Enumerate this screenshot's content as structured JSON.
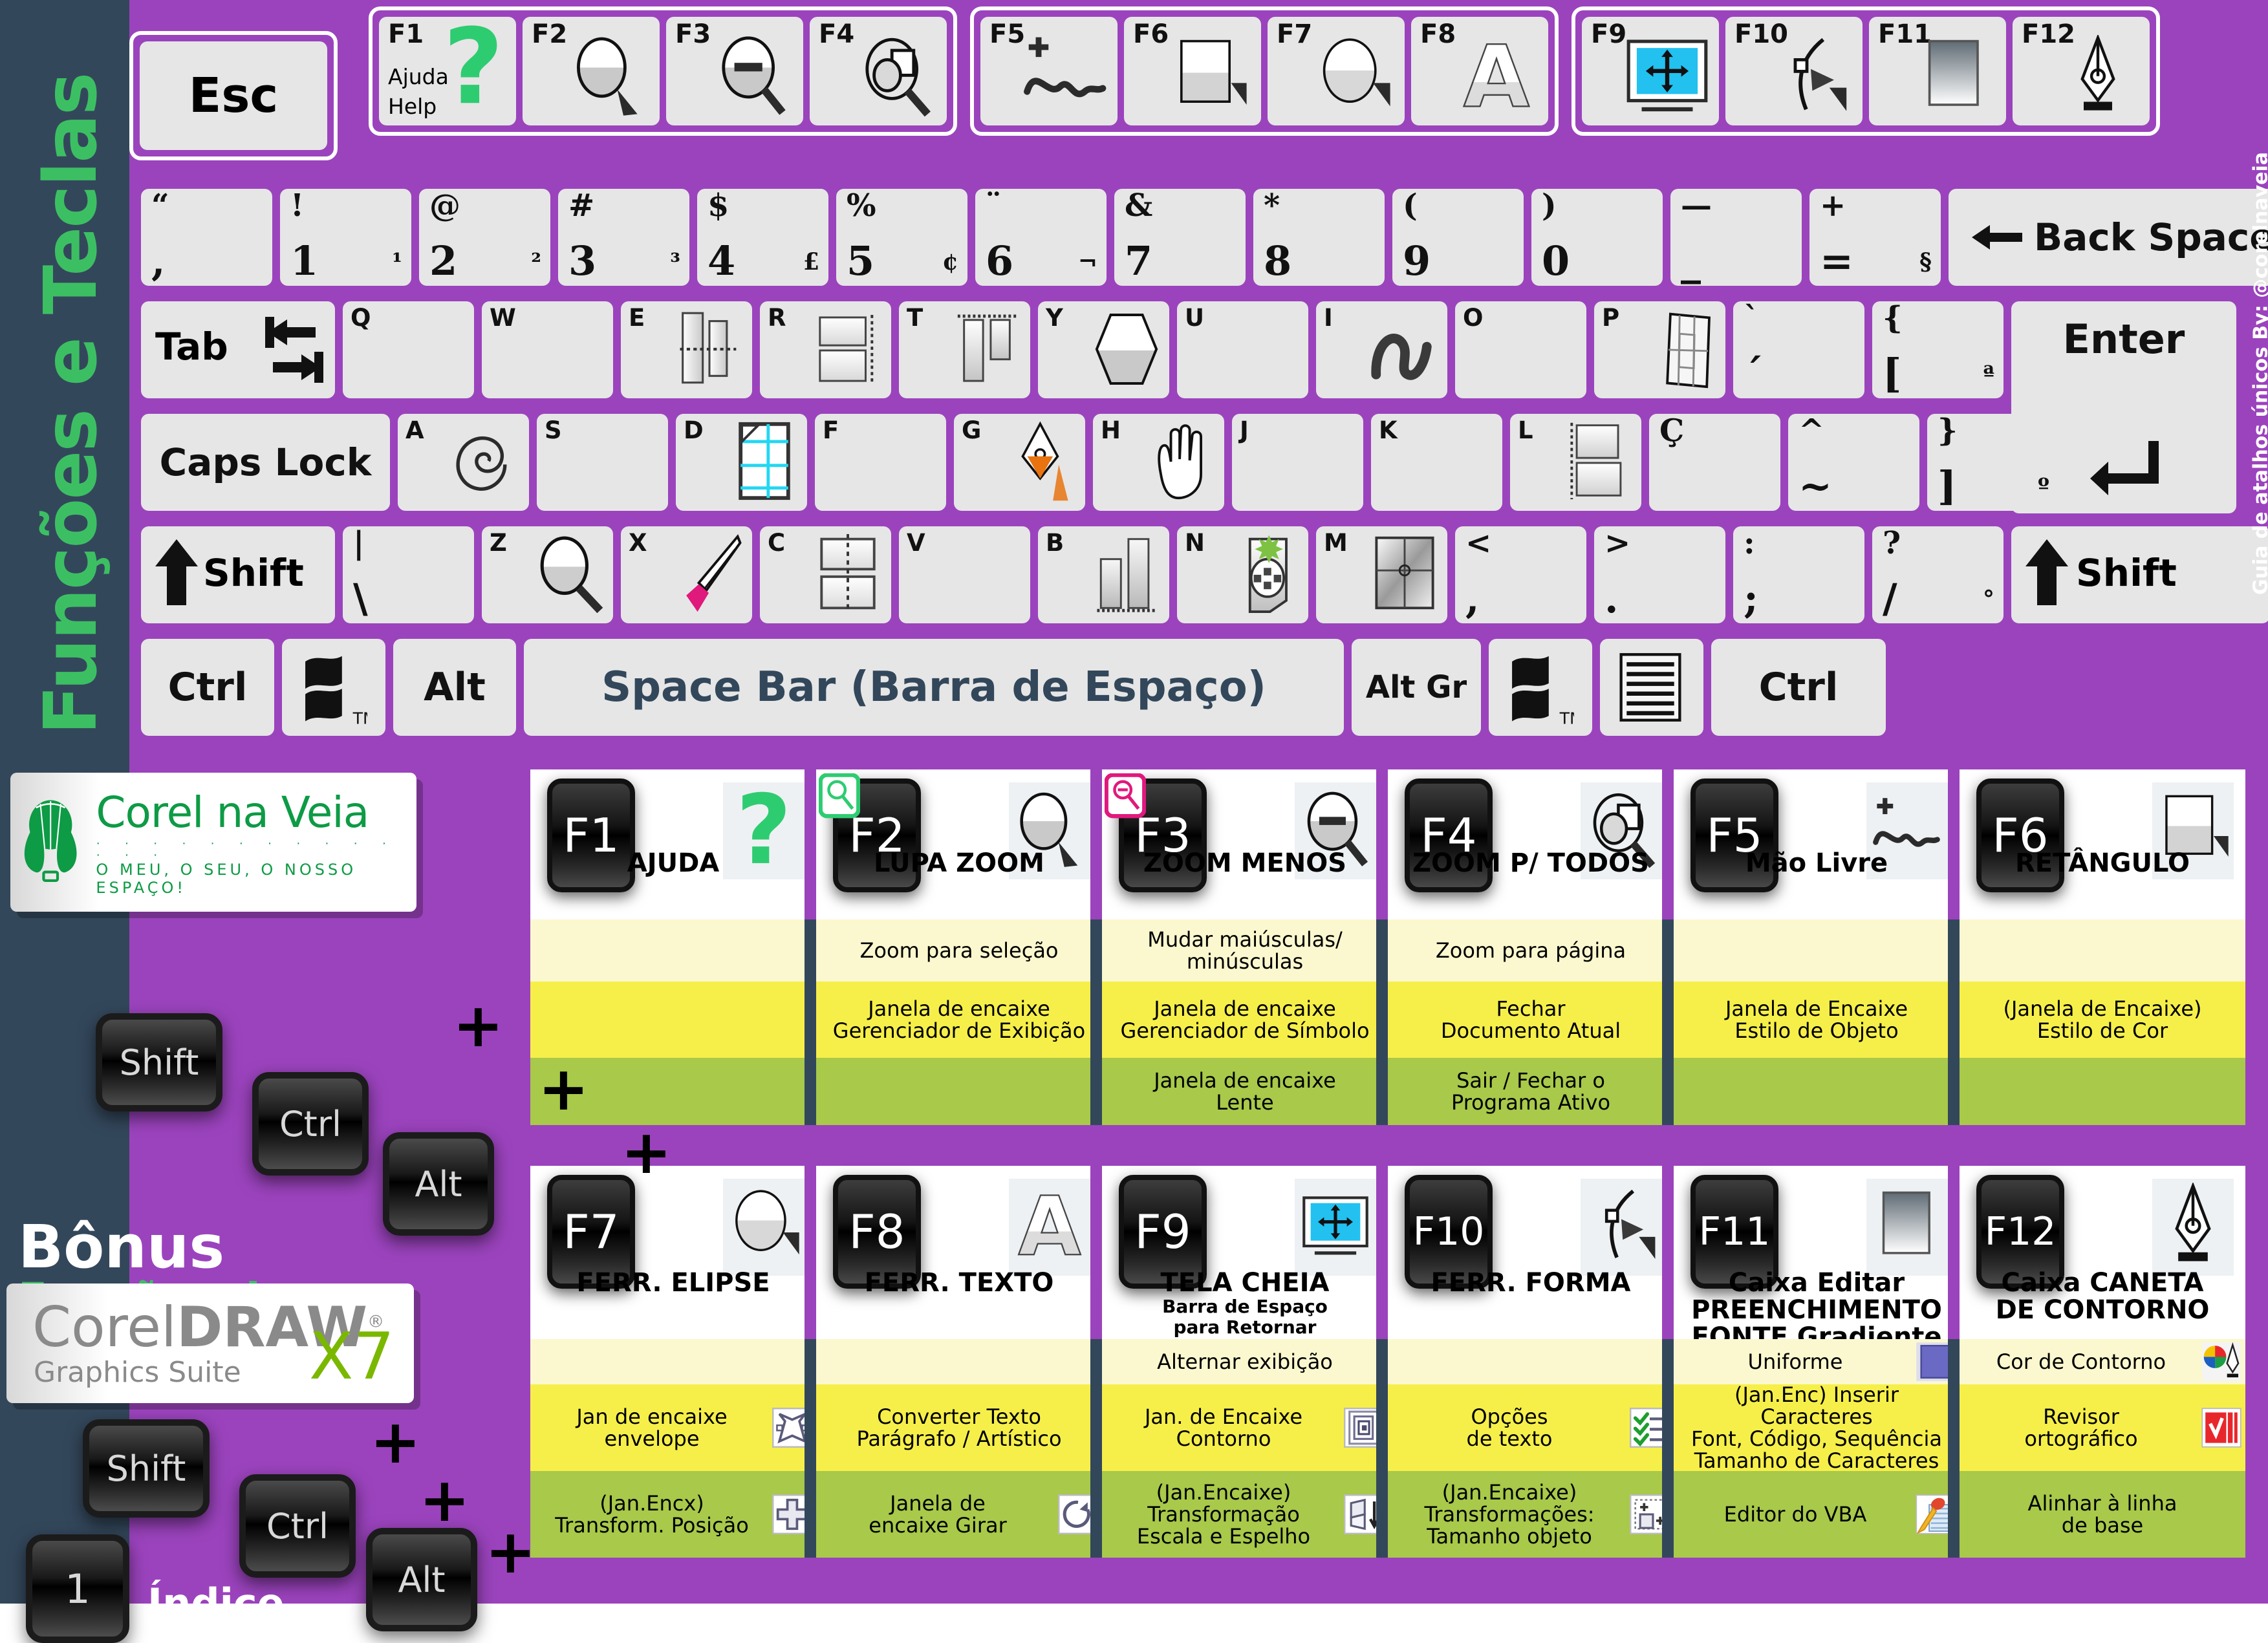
{
  "sidebar": {
    "title": "Funções e Teclas"
  },
  "right_credit": {
    "text": "Guia de atalhos únicos By: @corelnaveia"
  },
  "keyboard": {
    "esc": "Esc",
    "fn_top": [
      {
        "key": "F1",
        "icon": "help-question-icon",
        "label_top": "Ajuda",
        "label_bottom": "Help"
      },
      {
        "key": "F2",
        "icon": "zoom-in-magnifier-icon"
      },
      {
        "key": "F3",
        "icon": "zoom-out-magnifier-icon"
      },
      {
        "key": "F4",
        "icon": "zoom-all-objects-icon"
      },
      {
        "key": "F5",
        "icon": "freehand-curve-icon"
      },
      {
        "key": "F6",
        "icon": "rectangle-tool-icon"
      },
      {
        "key": "F7",
        "icon": "ellipse-tool-icon"
      },
      {
        "key": "F8",
        "icon": "text-tool-icon"
      },
      {
        "key": "F9",
        "icon": "fullscreen-preview-icon"
      },
      {
        "key": "F10",
        "icon": "shape-tool-icon"
      },
      {
        "key": "F11",
        "icon": "fountain-fill-icon"
      },
      {
        "key": "F12",
        "icon": "outline-pen-icon"
      }
    ],
    "number_row": [
      {
        "top": "“",
        "bottom": ","
      },
      {
        "top": "!",
        "bottom": "1",
        "alt": "¹"
      },
      {
        "top": "@",
        "bottom": "2",
        "alt": "²"
      },
      {
        "top": "#",
        "bottom": "3",
        "alt": "³"
      },
      {
        "top": "$",
        "bottom": "4",
        "alt": "£"
      },
      {
        "top": "%",
        "bottom": "5",
        "alt": "¢"
      },
      {
        "top": "¨",
        "bottom": "6",
        "alt": "¬"
      },
      {
        "top": "&",
        "bottom": "7"
      },
      {
        "top": "*",
        "bottom": "8"
      },
      {
        "top": "(",
        "bottom": "9"
      },
      {
        "top": ")",
        "bottom": "0"
      },
      {
        "top": "—",
        "bottom": "_"
      },
      {
        "top": "+",
        "bottom": "=",
        "alt": "§"
      }
    ],
    "backspace": "Back Space",
    "tab": "Tab",
    "qwerty_row": [
      {
        "letter": "Q",
        "icon": "none"
      },
      {
        "letter": "W",
        "icon": "none"
      },
      {
        "letter": "E",
        "icon": "blend-tool-icon"
      },
      {
        "letter": "R",
        "icon": "paragraph-align-right-icon"
      },
      {
        "letter": "T",
        "icon": "align-top-icon"
      },
      {
        "letter": "Y",
        "icon": "polygon-tool-icon"
      },
      {
        "letter": "U",
        "icon": "none"
      },
      {
        "letter": "I",
        "icon": "artistic-media-icon"
      },
      {
        "letter": "O",
        "icon": "none"
      },
      {
        "letter": "P",
        "icon": "perspective-grid-icon"
      }
    ],
    "qwerty_punct": [
      {
        "top": "`",
        "bottom": "´"
      },
      {
        "top": "{",
        "bottom": "[",
        "alt": "ª"
      }
    ],
    "enter": "Enter",
    "caps_lock": "Caps Lock",
    "asdf_row": [
      {
        "letter": "A",
        "icon": "spiral-tool-icon"
      },
      {
        "letter": "S",
        "icon": "none"
      },
      {
        "letter": "D",
        "icon": "graph-paper-tool-icon"
      },
      {
        "letter": "F",
        "icon": "none"
      },
      {
        "letter": "G",
        "icon": "interactive-fill-icon"
      },
      {
        "letter": "H",
        "icon": "pan-hand-icon"
      },
      {
        "letter": "J",
        "icon": "none"
      },
      {
        "letter": "K",
        "icon": "none"
      },
      {
        "letter": "L",
        "icon": "contour-align-icon"
      }
    ],
    "asdf_punct": [
      {
        "top": "Ç",
        "bottom": ""
      },
      {
        "top": "^",
        "bottom": "~"
      },
      {
        "top": "}",
        "bottom": "]",
        "alt": "º"
      }
    ],
    "shift": "Shift",
    "zxcv_row": [
      {
        "top": "|",
        "bottom": "\\"
      },
      {
        "letter": "Z",
        "icon": "zoom-tool-icon"
      },
      {
        "letter": "X",
        "icon": "eraser-tool-icon"
      },
      {
        "letter": "C",
        "icon": "mirror-vertical-icon"
      },
      {
        "letter": "V",
        "icon": "none"
      },
      {
        "letter": "B",
        "icon": "align-bottom-icon"
      },
      {
        "letter": "N",
        "icon": "smart-fill-icon"
      },
      {
        "letter": "M",
        "icon": "mesh-fill-icon"
      }
    ],
    "zxcv_punct": [
      {
        "top": "<",
        "bottom": ","
      },
      {
        "top": ">",
        "bottom": "."
      },
      {
        "top": ":",
        "bottom": ";"
      },
      {
        "top": "?",
        "bottom": "/",
        "alt": "°"
      }
    ],
    "ctrl": "Ctrl",
    "alt": "Alt",
    "alt_gr": "Alt Gr",
    "space_bar": "Space Bar (Barra de Espaço)",
    "win_icon": "windows-logo-icon",
    "menu_icon": "context-menu-icon"
  },
  "logo": {
    "name": "Corel na Veia",
    "tagline": "O MEU, O SEU, O NOSSO ESPAÇO!",
    "icon": "balloon-logo-icon"
  },
  "bonus": {
    "line1": "Bônus",
    "line2": "Funções do"
  },
  "product": {
    "name_light": "Corel",
    "name_bold": "DRAW",
    "reg": "®",
    "suite": "Graphics Suite",
    "version": "X7"
  },
  "modifiers": {
    "shift": "Shift",
    "ctrl": "Ctrl",
    "alt": "Alt",
    "plus": "+",
    "index_key": "1",
    "index_label": "Índice"
  },
  "colors": {
    "purple": "#9b43bd",
    "navy": "#33475b",
    "green": "#3cbf63",
    "row_shift": "#fbf8cf",
    "row_ctrl": "#f6ef4a",
    "row_alt": "#a8c94a"
  },
  "fkeys": [
    {
      "key": "F1",
      "name": "AJUDA",
      "sub": "",
      "icon": "help-question-icon",
      "badge": "",
      "shift": "",
      "ctrl": "",
      "alt": "",
      "shift_icon": "",
      "ctrl_icon": "",
      "alt_icon": ""
    },
    {
      "key": "F2",
      "name": "LUPA ZOOM",
      "sub": "",
      "icon": "zoom-in-magnifier-icon",
      "badge": "green-zoom-badge",
      "shift": "Zoom para seleção",
      "ctrl": "Janela de encaixe|Gerenciador de Exibição",
      "alt": "",
      "shift_icon": "",
      "ctrl_icon": "",
      "alt_icon": ""
    },
    {
      "key": "F3",
      "name": "ZOOM MENOS",
      "sub": "",
      "icon": "zoom-out-magnifier-icon",
      "badge": "pink-zoom-badge",
      "shift": "Mudar maiúsculas/|minúsculas",
      "ctrl": "Janela de encaixe|Gerenciador de Símbolo",
      "alt": "Janela de encaixe|Lente",
      "shift_icon": "",
      "ctrl_icon": "",
      "alt_icon": ""
    },
    {
      "key": "F4",
      "name": "ZOOM P/ TODOS",
      "sub": "",
      "icon": "zoom-all-objects-icon",
      "badge": "",
      "shift": "Zoom para página",
      "ctrl": "Fechar|Documento Atual",
      "alt": "Sair / Fechar o|Programa Ativo",
      "shift_icon": "",
      "ctrl_icon": "",
      "alt_icon": ""
    },
    {
      "key": "F5",
      "name": "Mão Livre",
      "sub": "",
      "icon": "freehand-curve-icon",
      "badge": "",
      "shift": "",
      "ctrl": "Janela de Encaixe|Estilo de Objeto",
      "alt": "",
      "shift_icon": "",
      "ctrl_icon": "",
      "alt_icon": ""
    },
    {
      "key": "F6",
      "name": "RETÂNGULO",
      "sub": "",
      "icon": "rectangle-tool-icon",
      "badge": "",
      "shift": "",
      "ctrl": "(Janela de Encaixe)|Estilo de Cor",
      "alt": "",
      "shift_icon": "",
      "ctrl_icon": "",
      "alt_icon": ""
    },
    {
      "key": "F7",
      "name": "FERR. ELIPSE",
      "sub": "",
      "icon": "ellipse-tool-icon",
      "badge": "",
      "shift": "",
      "ctrl": "Jan de encaixe|envelope",
      "alt": "(Jan.Encx)|Transform. Posição",
      "shift_icon": "",
      "ctrl_icon": "envelope-docker-icon",
      "alt_icon": "transform-position-icon"
    },
    {
      "key": "F8",
      "name": "FERR. TEXTO",
      "sub": "",
      "icon": "text-tool-icon",
      "badge": "",
      "shift": "",
      "ctrl": "Converter Texto|Parágrafo / Artístico",
      "alt": "Janela de|encaixe Girar",
      "shift_icon": "",
      "ctrl_icon": "",
      "alt_icon": "rotate-docker-icon"
    },
    {
      "key": "F9",
      "name": "TELA CHEIA",
      "sub": "Barra de Espaço|para Retornar",
      "icon": "fullscreen-preview-icon",
      "badge": "",
      "shift": "Alternar exibição",
      "ctrl": "Jan. de Encaixe|Contorno",
      "alt": "(Jan.Encaixe)|Transformação|Escala e Espelho",
      "shift_icon": "",
      "ctrl_icon": "contour-docker-icon",
      "alt_icon": "scale-mirror-icon"
    },
    {
      "key": "F10",
      "name": "FERR. FORMA",
      "sub": "",
      "icon": "shape-tool-icon",
      "badge": "",
      "shift": "",
      "ctrl": "Opções|de texto",
      "alt": "(Jan.Encaixe)|Transformações:|Tamanho objeto",
      "shift_icon": "",
      "ctrl_icon": "text-options-icon",
      "alt_icon": "object-size-icon"
    },
    {
      "key": "F11",
      "name": "Caixa Editar|PREENCHIMENTO|FONTE Gradiente",
      "sub": "",
      "icon": "fountain-fill-icon",
      "badge": "",
      "shift": "Uniforme",
      "ctrl": "(Jan.Enc) Inserir Caracteres|Font, Código, Sequência|Tamanho de Caracteres",
      "alt": "Editor do VBA",
      "shift_icon": "uniform-fill-icon",
      "ctrl_icon": "",
      "alt_icon": "vba-editor-icon"
    },
    {
      "key": "F12",
      "name": "Caixa CANETA|DE CONTORNO",
      "sub": "",
      "icon": "outline-pen-icon",
      "badge": "",
      "shift": "Cor de Contorno",
      "ctrl": "Revisor|ortográfico",
      "alt": "Alinhar à linha|de base",
      "shift_icon": "outline-color-icon",
      "ctrl_icon": "spellcheck-icon",
      "alt_icon": ""
    }
  ]
}
